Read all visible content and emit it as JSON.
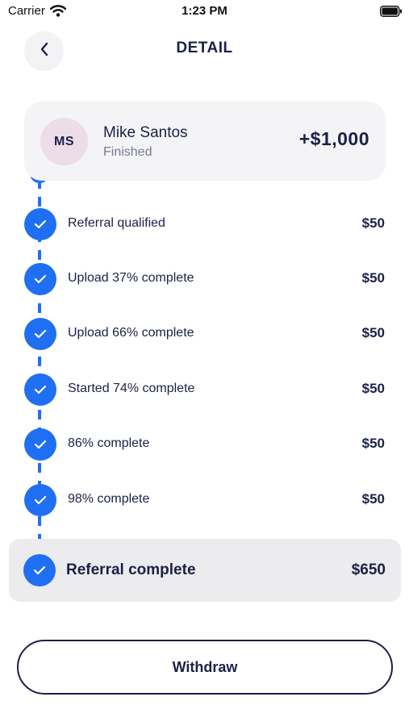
{
  "status_bar": {
    "carrier": "Carrier",
    "time": "1:23 PM"
  },
  "header": {
    "title": "DETAIL"
  },
  "profile": {
    "initials": "MS",
    "name": "Mike Santos",
    "status": "Finished",
    "total": "+$1,000"
  },
  "steps": [
    {
      "label": "Referral qualified",
      "amount": "$50"
    },
    {
      "label": "Upload 37% complete",
      "amount": "$50"
    },
    {
      "label": "Upload 66% complete",
      "amount": "$50"
    },
    {
      "label": "Started 74% complete",
      "amount": "$50"
    },
    {
      "label": "86% complete",
      "amount": "$50"
    },
    {
      "label": "98% complete",
      "amount": "$50"
    }
  ],
  "final_step": {
    "label": "Referral complete",
    "amount": "$650"
  },
  "actions": {
    "withdraw_label": "Withdraw"
  },
  "colors": {
    "accent": "#1f6ff2",
    "text": "#1b2147",
    "card": "#f4f4f7",
    "avatar_bg": "#ecdde8"
  }
}
